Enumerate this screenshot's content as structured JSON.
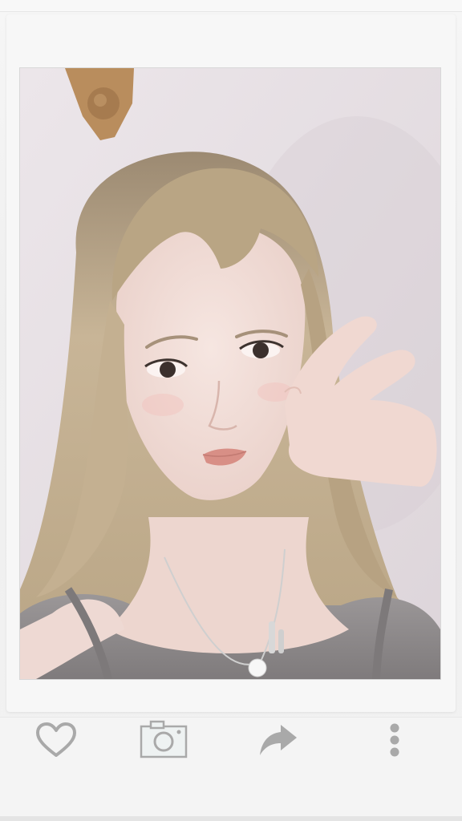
{
  "post": {
    "photo": {
      "subject": "selfie-portrait",
      "colors": {
        "wall": "#e8e2e6",
        "hair": "#c2ad8d",
        "skin": "#f1dcd6",
        "top": "#8e8a8b",
        "hook": "#b98d5d"
      }
    },
    "actions": {
      "like_icon": "heart-icon",
      "camera_icon": "camera-icon",
      "share_icon": "share-arrow-icon",
      "more_icon": "more-vertical-icon"
    },
    "icon_color": "#a9a9a9"
  }
}
